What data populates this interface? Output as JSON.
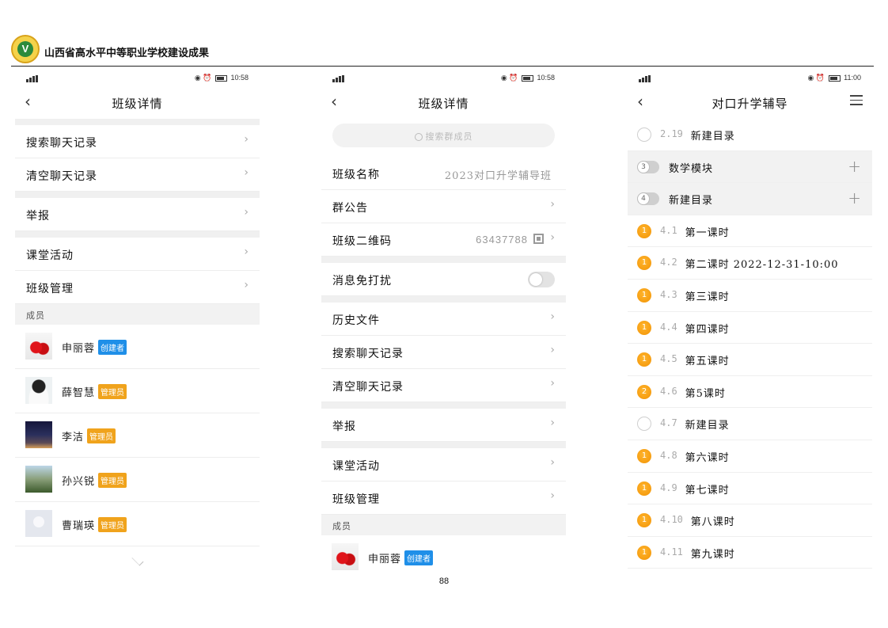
{
  "doc": {
    "title": "山西省高水平中等职业学校建设成果",
    "page_number": "88",
    "logo_letter": "V"
  },
  "phone1": {
    "time": "10:58",
    "title": "班级详情",
    "rows": [
      "搜索聊天记录",
      "清空聊天记录",
      "举报",
      "课堂活动",
      "班级管理"
    ],
    "section": "成员",
    "members": [
      {
        "name": "申丽蓉",
        "badge": "创建者",
        "avatar": "cherry"
      },
      {
        "name": "薛智慧",
        "badge": "管理员",
        "avatar": "woman"
      },
      {
        "name": "李洁",
        "badge": "管理员",
        "avatar": "night"
      },
      {
        "name": "孙兴锐",
        "badge": "管理员",
        "avatar": "pavilion"
      },
      {
        "name": "曹瑞瑛",
        "badge": "管理员",
        "avatar": "default"
      }
    ]
  },
  "phone2": {
    "time": "10:58",
    "title": "班级详情",
    "search_placeholder": "搜索群成员",
    "class_name_label": "班级名称",
    "class_name_value": "2023对口升学辅导班",
    "notice_label": "群公告",
    "qr_label": "班级二维码",
    "qr_value": "63437788",
    "dnd_label": "消息免打扰",
    "rows": [
      "历史文件",
      "搜索聊天记录",
      "清空聊天记录",
      "举报",
      "课堂活动",
      "班级管理"
    ],
    "section": "成员",
    "member": {
      "name": "申丽蓉",
      "badge": "创建者"
    }
  },
  "phone3": {
    "time": "11:00",
    "title": "对口升学辅导",
    "items": [
      {
        "num": "2.19",
        "text": "新建目录",
        "marker": "empty",
        "badge": ""
      },
      {
        "num": "",
        "text": "数学模块",
        "marker": "toggle",
        "badge": "3"
      },
      {
        "num": "",
        "text": "新建目录",
        "marker": "toggle",
        "badge": "4"
      },
      {
        "num": "4.1",
        "text": "第一课时",
        "marker": "orange",
        "badge": "1"
      },
      {
        "num": "4.2",
        "text": "第二课时 2022-12-31-10:00",
        "marker": "orange",
        "badge": "1"
      },
      {
        "num": "4.3",
        "text": "第三课时",
        "marker": "orange",
        "badge": "1"
      },
      {
        "num": "4.4",
        "text": "第四课时",
        "marker": "orange",
        "badge": "1"
      },
      {
        "num": "4.5",
        "text": "第五课时",
        "marker": "orange",
        "badge": "1"
      },
      {
        "num": "4.6",
        "text": "第5课时",
        "marker": "orange",
        "badge": "2"
      },
      {
        "num": "4.7",
        "text": "新建目录",
        "marker": "empty",
        "badge": ""
      },
      {
        "num": "4.8",
        "text": "第六课时",
        "marker": "orange",
        "badge": "1"
      },
      {
        "num": "4.9",
        "text": "第七课时",
        "marker": "orange",
        "badge": "1"
      },
      {
        "num": "4.10",
        "text": "第八课时",
        "marker": "orange",
        "badge": "1"
      },
      {
        "num": "4.11",
        "text": "第九课时",
        "marker": "orange",
        "badge": "1"
      }
    ]
  }
}
